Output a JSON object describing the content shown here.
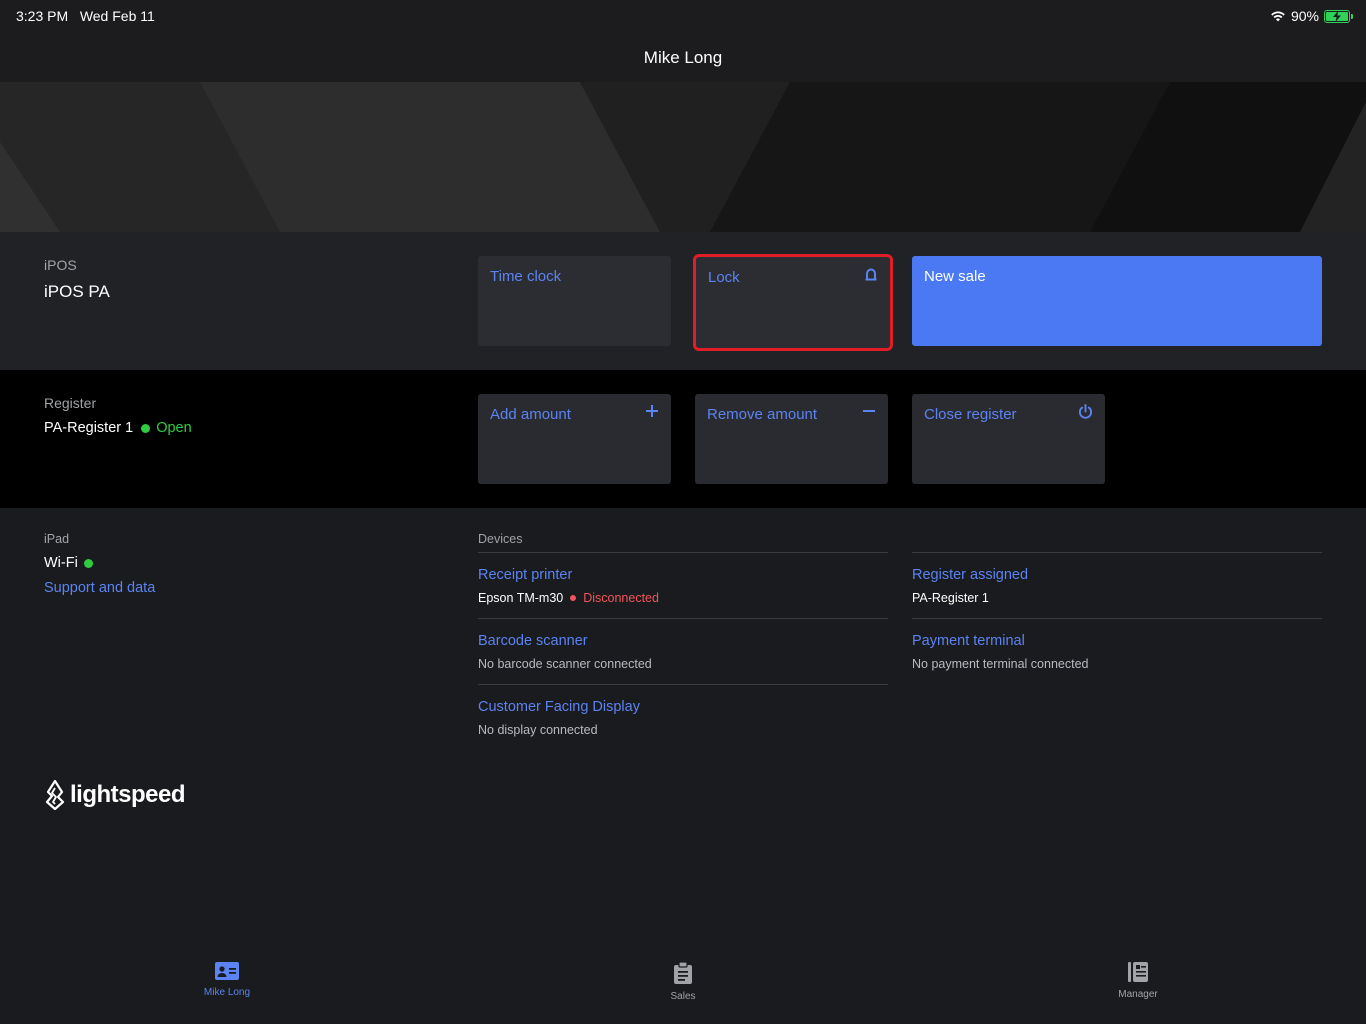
{
  "status_bar": {
    "time": "3:23 PM",
    "date": "Wed Feb 11",
    "battery": "90%",
    "battery_level": 0.9
  },
  "nav": {
    "title": "Mike Long"
  },
  "ipos": {
    "caption": "iPOS",
    "name": "iPOS PA",
    "tiles": {
      "time_clock": "Time clock",
      "lock": "Lock",
      "new_sale": "New sale"
    }
  },
  "register": {
    "caption": "Register",
    "name": "PA-Register 1",
    "status": "Open",
    "tiles": {
      "add_amount": "Add amount",
      "remove_amount": "Remove amount",
      "close_register": "Close register"
    }
  },
  "ipad": {
    "caption": "iPad",
    "wifi_label": "Wi-Fi",
    "support_link": "Support and data"
  },
  "devices": {
    "caption": "Devices",
    "receipt_printer": {
      "title": "Receipt printer",
      "model": "Epson TM-m30",
      "status": "Disconnected"
    },
    "barcode_scanner": {
      "title": "Barcode scanner",
      "status": "No barcode scanner connected"
    },
    "customer_display": {
      "title": "Customer Facing Display",
      "status": "No display connected"
    },
    "register_assigned": {
      "title": "Register assigned",
      "value": "PA-Register 1"
    },
    "payment_terminal": {
      "title": "Payment terminal",
      "status": "No payment terminal connected"
    }
  },
  "brand": {
    "logo_text": "lightspeed"
  },
  "tabs": [
    {
      "label": "Mike Long",
      "icon": "id-card-icon"
    },
    {
      "label": "Sales",
      "icon": "clipboard-icon"
    },
    {
      "label": "Manager",
      "icon": "ledger-icon"
    }
  ],
  "colors": {
    "accent": "#5b83f2",
    "primary_button": "#4a79f3",
    "open_status": "#2ecc40",
    "disconnected_status": "#f2545b",
    "highlight_outline": "#e11d28"
  }
}
